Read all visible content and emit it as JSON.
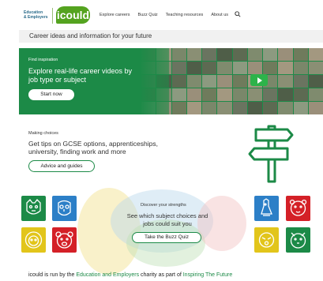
{
  "header": {
    "ee_logo_line1": "Education",
    "ee_logo_line2": "& Employers",
    "brand": "icould",
    "nav": [
      "Explore careers",
      "Buzz Quiz",
      "Teaching resources",
      "About us"
    ]
  },
  "strip": {
    "text": "Career ideas and information for your future"
  },
  "hero": {
    "kicker": "Find inspiration",
    "title": "Explore real-life career videos by job type or subject",
    "button": "Start now"
  },
  "choices": {
    "kicker": "Making choices",
    "text": "Get tips on GCSE options, apprenticeships, university, finding work and more",
    "button": "Advice and guides"
  },
  "quiz": {
    "kicker": "Discover your strengths",
    "text": "See which subject choices and jobs could suit you",
    "button": "Take the Buzz Quiz"
  },
  "footer": {
    "prefix": "icould is run by the ",
    "link1": "Education and Employers",
    "middle": " charity as part of ",
    "link2": "Inspiring The Future"
  },
  "colors": {
    "brand_green": "#54a31f",
    "dark_green": "#1c8a47"
  }
}
